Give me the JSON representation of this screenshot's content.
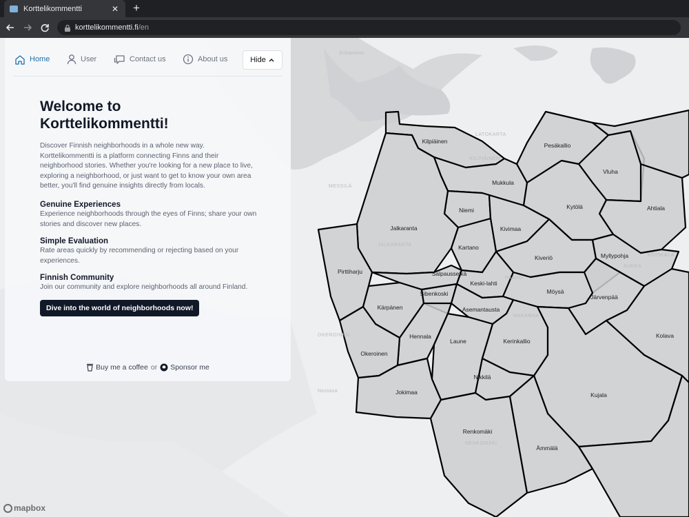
{
  "browser": {
    "tab_title": "Korttelikommentti",
    "tab_close": "✕",
    "new_tab": "+",
    "url_host": "korttelikommentti.fi",
    "url_path": "/en"
  },
  "nav": {
    "home": "Home",
    "user": "User",
    "contact": "Contact us",
    "about": "About us",
    "hide": "Hide",
    "active_color": "#1d6fa8"
  },
  "hero": {
    "title_line1": "Welcome to",
    "title_line2": "Korttelikommentti!",
    "intro": "Discover Finnish neighborhoods in a whole new way. Korttelikommentti is a platform connecting Finns and their neighborhood stories. Whether you're looking for a new place to live, exploring a neighborhood, or just want to get to know your own area better, you'll find genuine insights directly from locals.",
    "sections": [
      {
        "title": "Genuine Experiences",
        "text": "Experience neighborhoods through the eyes of Finns; share your own stories and discover new places."
      },
      {
        "title": "Simple Evaluation",
        "text": "Rate areas quickly by recommending or rejecting based on your experiences."
      },
      {
        "title": "Finnish Community",
        "text": "Join our community and explore neighborhoods all around Finland."
      }
    ],
    "cta": "Dive into the world of neighborhoods now!"
  },
  "footer": {
    "coffee": "Buy me a coffee",
    "or": "or",
    "sponsor": "Sponsor me"
  },
  "map": {
    "attribution": "mapbox",
    "place_labels": [
      "Siikaniemi",
      "LATOKARTA",
      "KILPIÄINEN",
      "MESSILÄ",
      "JALKARANTA",
      "PAAVO",
      "OKEROINEN",
      "Nostava",
      "KOISKALA",
      "HAKAMAA",
      "AUKKA",
      "RENKOMÄKI"
    ],
    "neighborhoods": [
      "Kilpiäinen",
      "Pesäkallio",
      "Vluha",
      "Ahtiala",
      "Mukkula",
      "Kytölä",
      "Niemi",
      "Jalkaranta",
      "Kivimaa",
      "Kartano",
      "Kiveriö",
      "Myllypohja",
      "Pirttiharju",
      "Salpausselkä",
      "Keski-lahti",
      "Möysä",
      "Järvenpää",
      "Kärpänen",
      "Sibenkoski",
      "Asemantausta",
      "Kolava",
      "Hennala",
      "Laune",
      "Kerinkallio",
      "Okeroinen",
      "Nikkilä",
      "Jokimaa",
      "Kujala",
      "Renkomäki",
      "Ämmälä"
    ]
  }
}
